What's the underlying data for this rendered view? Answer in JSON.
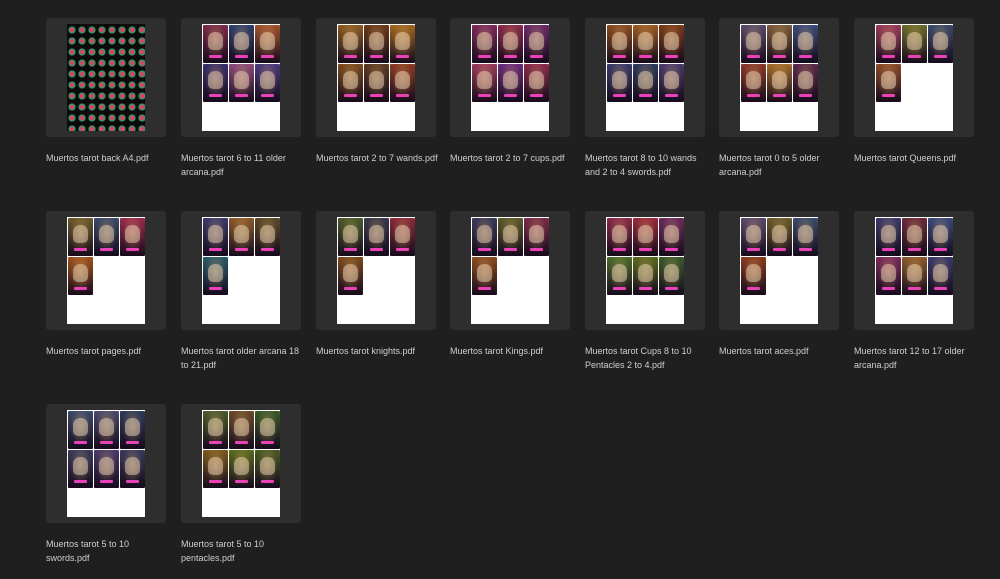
{
  "files": [
    {
      "name": "Muertos tarot back A4.pdf",
      "preview": "pattern",
      "cards": []
    },
    {
      "name": "Muertos tarot 6 to 11 older arcana.pdf",
      "preview": "cards",
      "cards": [
        "#7a2a4a",
        "#2e3f6e",
        "#a0522d",
        "#3a2f6a",
        "#8a4a7a",
        "#4a3a7a"
      ]
    },
    {
      "name": "Muertos tarot 2 to 7 wands.pdf",
      "preview": "cards",
      "cards": [
        "#8a5a22",
        "#6a3a1a",
        "#a0661e",
        "#7a4a1e",
        "#5a3a22",
        "#8a3a22"
      ]
    },
    {
      "name": "Muertos tarot 2 to 7 cups.pdf",
      "preview": "cards",
      "cards": [
        "#7a2a5a",
        "#8a2a4a",
        "#6a2a6a",
        "#9a3a5a",
        "#6a2a7a",
        "#8a2a4a"
      ]
    },
    {
      "name": "Muertos tarot 8 to 10 wands and 2 to 4 swords.pdf",
      "preview": "cards",
      "cards": [
        "#8a4a1e",
        "#9a5a22",
        "#7a3a1a",
        "#3a3a6a",
        "#2e3a5a",
        "#4a3a6a"
      ]
    },
    {
      "name": "Muertos tarot 0 to 5 older arcana.pdf",
      "preview": "cards",
      "cards": [
        "#5a4a6a",
        "#7a5a3a",
        "#3a4a7a",
        "#8a3a2a",
        "#a06a2a",
        "#5a2a4a"
      ]
    },
    {
      "name": "Muertos tarot Queens.pdf",
      "preview": "cards",
      "cards": [
        "#9a3a5a",
        "#6a6a2a",
        "#3a4a6a",
        "#8a4a2a"
      ]
    },
    {
      "name": "Muertos tarot pages.pdf",
      "preview": "cards",
      "cards": [
        "#6a5a2a",
        "#3a4a6a",
        "#9a2a4a",
        "#a0521e"
      ]
    },
    {
      "name": "Muertos tarot older arcana 18 to 21.pdf",
      "preview": "cards",
      "cards": [
        "#3a3a6a",
        "#8a5a2a",
        "#5a4a2a",
        "#2a5a6a"
      ]
    },
    {
      "name": "Muertos tarot knights.pdf",
      "preview": "cards",
      "cards": [
        "#4a5a2a",
        "#3a3a4a",
        "#8a2a3a",
        "#7a4a1e"
      ]
    },
    {
      "name": "Muertos tarot Kings.pdf",
      "preview": "cards",
      "cards": [
        "#3a3a5a",
        "#5a5a2a",
        "#7a2a4a",
        "#8a4a1e"
      ]
    },
    {
      "name": "Muertos tarot Cups 8 to 10 Pentacles 2 to 4.pdf",
      "preview": "cards",
      "cards": [
        "#8a2a4a",
        "#9a2a3a",
        "#6a2a5a",
        "#4a6a2a",
        "#5a6a1e",
        "#3a5a2a"
      ]
    },
    {
      "name": "Muertos tarot aces.pdf",
      "preview": "cards",
      "cards": [
        "#5a4a6a",
        "#6a5a2a",
        "#3a4a6a",
        "#8a3a1e"
      ]
    },
    {
      "name": "Muertos tarot 12 to 17 older arcana.pdf",
      "preview": "cards",
      "cards": [
        "#3a3a6a",
        "#6a2a3a",
        "#3a4a7a",
        "#7a2a5a",
        "#8a5a2a",
        "#3a3a6a"
      ]
    },
    {
      "name": "Muertos tarot 5 to 10 swords.pdf",
      "preview": "cards",
      "cards": [
        "#3a4a6a",
        "#4a4a6a",
        "#2e3a5a",
        "#3a3a5a",
        "#4a3a6a",
        "#3a3a5a"
      ]
    },
    {
      "name": "Muertos tarot 5 to 10 pentacles.pdf",
      "preview": "cards",
      "cards": [
        "#4a5a2a",
        "#6a4a2a",
        "#3a5a2a",
        "#7a5a1e",
        "#5a6a1e",
        "#4a5a22"
      ]
    }
  ]
}
